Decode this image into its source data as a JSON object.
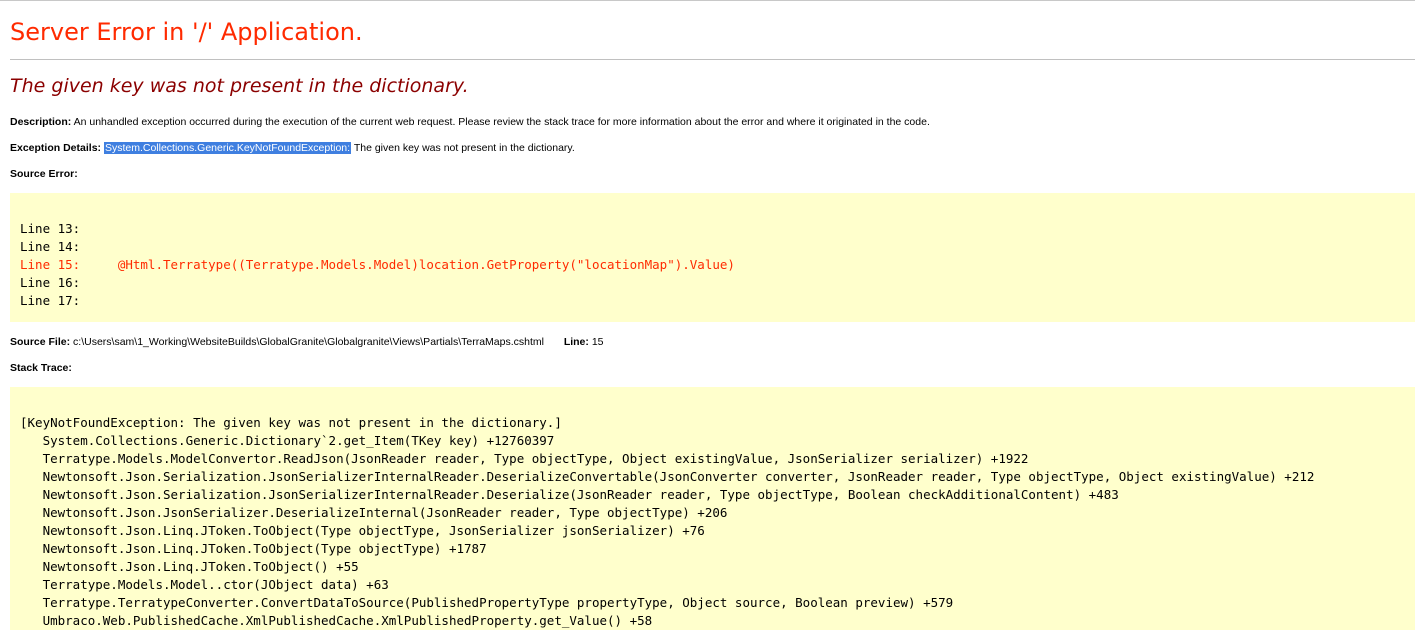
{
  "title": "Server Error in '/' Application.",
  "error_message": "The given key was not present in the dictionary.",
  "description": {
    "label": "Description:",
    "text": "An unhandled exception occurred during the execution of the current web request. Please review the stack trace for more information about the error and where it originated in the code."
  },
  "exception": {
    "label": "Exception Details:",
    "type": "System.Collections.Generic.KeyNotFoundException:",
    "text": "The given key was not present in the dictionary."
  },
  "source_error": {
    "label": "Source Error:",
    "lines": [
      "Line 13:",
      "Line 14:",
      "Line 15:     @Html.Terratype((Terratype.Models.Model)location.GetProperty(\"locationMap\").Value)",
      "Line 16:",
      "Line 17:"
    ]
  },
  "source_file": {
    "label": "Source File:",
    "path": "c:\\Users\\sam\\1_Working\\WebsiteBuilds\\GlobalGranite\\Globalgranite\\Views\\Partials\\TerraMaps.cshtml",
    "line_label": "Line:",
    "line_number": "15"
  },
  "stack_trace": {
    "label": "Stack Trace:",
    "lines": [
      "[KeyNotFoundException: The given key was not present in the dictionary.]",
      "   System.Collections.Generic.Dictionary`2.get_Item(TKey key) +12760397",
      "   Terratype.Models.ModelConvertor.ReadJson(JsonReader reader, Type objectType, Object existingValue, JsonSerializer serializer) +1922",
      "   Newtonsoft.Json.Serialization.JsonSerializerInternalReader.DeserializeConvertable(JsonConverter converter, JsonReader reader, Type objectType, Object existingValue) +212",
      "   Newtonsoft.Json.Serialization.JsonSerializerInternalReader.Deserialize(JsonReader reader, Type objectType, Boolean checkAdditionalContent) +483",
      "   Newtonsoft.Json.JsonSerializer.DeserializeInternal(JsonReader reader, Type objectType) +206",
      "   Newtonsoft.Json.Linq.JToken.ToObject(Type objectType, JsonSerializer jsonSerializer) +76",
      "   Newtonsoft.Json.Linq.JToken.ToObject(Type objectType) +1787",
      "   Newtonsoft.Json.Linq.JToken.ToObject() +55",
      "   Terratype.Models.Model..ctor(JObject data) +63",
      "   Terratype.TerratypeConverter.ConvertDataToSource(PublishedPropertyType propertyType, Object source, Boolean preview) +579",
      "   Umbraco.Web.PublishedCache.XmlPublishedCache.XmlPublishedProperty.get_Value() +58"
    ]
  },
  "colors": {
    "title": "#ff2a00",
    "error_message": "#8b0000",
    "code_background": "#ffffcc",
    "highlight_line": "#ff2a00",
    "selection": "#3f7fe0"
  }
}
